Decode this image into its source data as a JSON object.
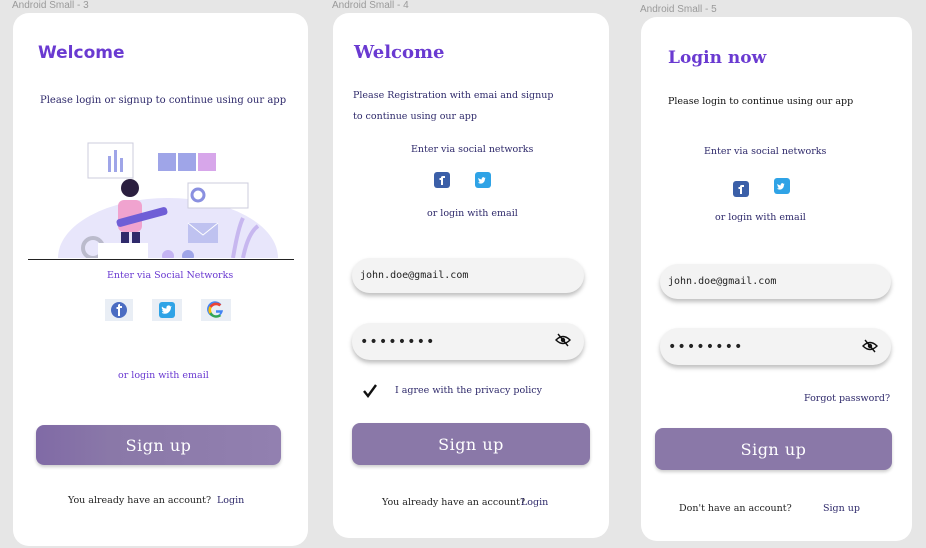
{
  "frames": [
    {
      "label": "Android Small - 3"
    },
    {
      "label": "Android Small - 4"
    },
    {
      "label": "Android Small - 5"
    }
  ],
  "screen1": {
    "title": "Welcome",
    "subtitle_a": "Please login or ",
    "subtitle_b": "signup to continue using our app",
    "social_label": "Enter via Social Networks",
    "or_email": "or login with email",
    "signup_button": "Sign up",
    "have_account": "You already have an account?",
    "login_link": "Login"
  },
  "screen2": {
    "title": "Welcome",
    "subtitle_line1": "Please Registration  with emai and signup",
    "subtitle_line2": "to continue using our app",
    "social_label": "Enter via social networks",
    "or_email": "or login with email",
    "email_value": "john.doe@gmail.com",
    "password_value": "••••••••",
    "agree_text": "I agree with the privacy policy",
    "signup_button": "Sign up",
    "have_account": "You already have an account?",
    "login_link": "Login"
  },
  "screen3": {
    "title": "Login now",
    "subtitle": "Please login to continue using our app",
    "social_label": "Enter via social networks",
    "or_email": "or login with email",
    "email_value": "john.doe@gmail.com",
    "password_value": "••••••••",
    "forgot_password": "Forgot password?",
    "signup_button": "Sign up",
    "no_account": "Don't have an account?",
    "signup_link": "Sign up"
  },
  "colors": {
    "accent_purple": "#6a3ad1",
    "button": "#8a78a8",
    "navy": "#2f2a6b"
  },
  "icons": [
    "facebook-icon",
    "twitter-icon",
    "google-icon",
    "eye-slash-icon",
    "checkmark-icon"
  ]
}
